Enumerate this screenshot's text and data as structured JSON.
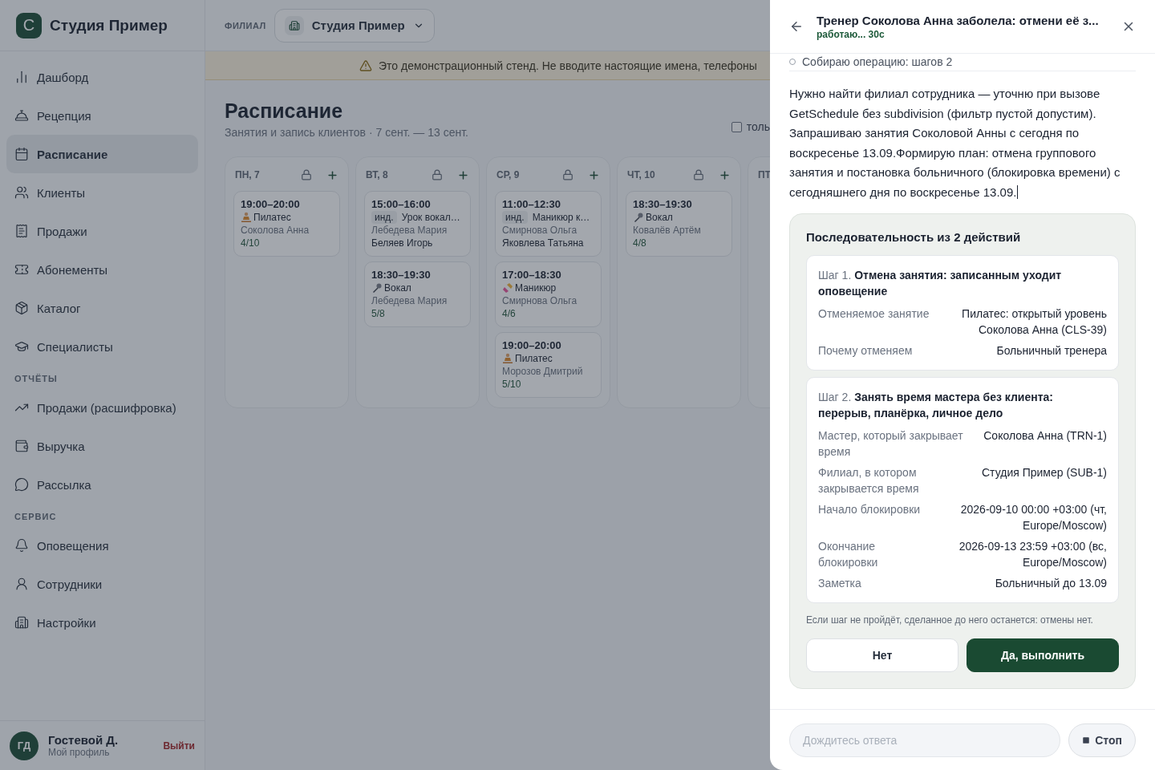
{
  "brand": {
    "logo": "С",
    "name": "Студия Пример"
  },
  "sidebar": [
    {
      "kind": "item",
      "label": "Дашборд",
      "selected": false
    },
    {
      "kind": "item",
      "label": "Рецепция",
      "selected": false
    },
    {
      "kind": "item",
      "label": "Расписание",
      "selected": true
    },
    {
      "kind": "item",
      "label": "Клиенты",
      "selected": false
    },
    {
      "kind": "item",
      "label": "Продажи",
      "selected": false
    },
    {
      "kind": "item",
      "label": "Абонементы",
      "selected": false
    },
    {
      "kind": "item",
      "label": "Каталог",
      "selected": false
    },
    {
      "kind": "item",
      "label": "Специалисты",
      "selected": false
    },
    {
      "kind": "section",
      "label": "ОТЧЁТЫ"
    },
    {
      "kind": "item",
      "label": "Продажи (расшифровка)",
      "selected": false
    },
    {
      "kind": "item",
      "label": "Выручка",
      "selected": false
    },
    {
      "kind": "item",
      "label": "Рассылка",
      "selected": false
    },
    {
      "kind": "section",
      "label": "СЕРВИС"
    },
    {
      "kind": "item",
      "label": "Оповещения",
      "selected": false
    },
    {
      "kind": "item",
      "label": "Сотрудники",
      "selected": false
    },
    {
      "kind": "item",
      "label": "Настройки",
      "selected": false
    }
  ],
  "user": {
    "initials": "ГД",
    "name": "Гостевой Д.",
    "profile": "Мой профиль",
    "logout": "Выйти"
  },
  "topbar": {
    "label": "ФИЛИАЛ",
    "branch": "Студия Пример"
  },
  "banner": "Это демонстрационный стенд. Не вводите настоящие имена, телефоны",
  "page": {
    "title": "Расписание",
    "subtitle": "Занятия и запись клиентов · 7 сент. — 13 сент.",
    "filter_label": "толь",
    "filter_checked": false
  },
  "days": [
    {
      "label": "ПН, 7",
      "classes": [
        {
          "time": "19:00–20:00",
          "kind": "yoga",
          "title": "Пилатес",
          "trainer": "Соколова Анна",
          "count": "4/10"
        }
      ]
    },
    {
      "label": "ВТ, 8",
      "classes": [
        {
          "time": "15:00–16:00",
          "kind": "individual",
          "tag": "инд.",
          "title": "Урок вокал…",
          "trainer": "Лебедева Мария",
          "client": "Беляев Игорь"
        },
        {
          "time": "18:30–19:30",
          "kind": "mic",
          "title": "Вокал",
          "trainer": "Лебедева Мария",
          "count": "5/8"
        }
      ]
    },
    {
      "label": "СР, 9",
      "classes": [
        {
          "time": "11:00–12:30",
          "kind": "individual",
          "tag": "инд.",
          "title": "Маникюр к…",
          "trainer": "Смирнова Ольга",
          "client": "Яковлева Татьяна"
        },
        {
          "time": "17:00–18:30",
          "kind": "nails",
          "title": "Маникюр",
          "trainer": "Смирнова Ольга",
          "count": "4/6"
        },
        {
          "time": "19:00–20:00",
          "kind": "yoga",
          "title": "Пилатес",
          "trainer": "Морозов Дмитрий",
          "count": "5/10"
        }
      ]
    },
    {
      "label": "ЧТ, 10",
      "classes": [
        {
          "time": "18:30–19:30",
          "kind": "mic",
          "title": "Вокал",
          "trainer": "Ковалёв Артём",
          "count": "4/8"
        }
      ]
    },
    {
      "label": "ПТ"
    }
  ],
  "assistant": {
    "title": "Тренер Соколова Анна заболела: отмени её з...",
    "status": "работаю... 30с",
    "progress": "Собираю операцию: шагов 2",
    "message": "Нужно найти филиал сотрудника — уточню при вызове GetSchedule без subdivision (фильтр пустой допустим). Запрашиваю занятия Соколовой Анны с сегодня по воскресенье 13.09.Формирую план: отмена группового занятия и постановка больничного (блокировка времени) с сегодняшнего дня по воскресенье 13.09.",
    "plan": {
      "title": "Последовательность из 2 действий",
      "steps": [
        {
          "number": "Шаг 1.",
          "title": "Отмена занятия: записанным уходит оповещение",
          "rows": [
            {
              "label": "Отменяемое занятие",
              "value": "Пилатес: открытый уровень Соколова Анна (CLS-39)"
            },
            {
              "label": "Почему отменяем",
              "value": "Больничный тренера"
            }
          ]
        },
        {
          "number": "Шаг 2.",
          "title": "Занять время мастера без клиента: перерыв, планёрка, личное дело",
          "rows": [
            {
              "label": "Мастер, который закрывает время",
              "value": "Соколова Анна (TRN-1)"
            },
            {
              "label": "Филиал, в котором закрывается время",
              "value": "Студия Пример (SUB-1)"
            },
            {
              "label": "Начало блокировки",
              "value": "2026-09-10 00:00 +03:00 (чт, Europe/Moscow)"
            },
            {
              "label": "Окончание блокировки",
              "value": "2026-09-13 23:59 +03:00 (вс, Europe/Moscow)"
            },
            {
              "label": "Заметка",
              "value": "Больничный до 13.09"
            }
          ]
        }
      ],
      "note": "Если шаг не пройдёт, сделанное до него останется: отмены нет.",
      "cancel": "Нет",
      "confirm": "Да, выполнить"
    },
    "input_placeholder": "Дождитесь ответа",
    "stop": "Стоп"
  }
}
